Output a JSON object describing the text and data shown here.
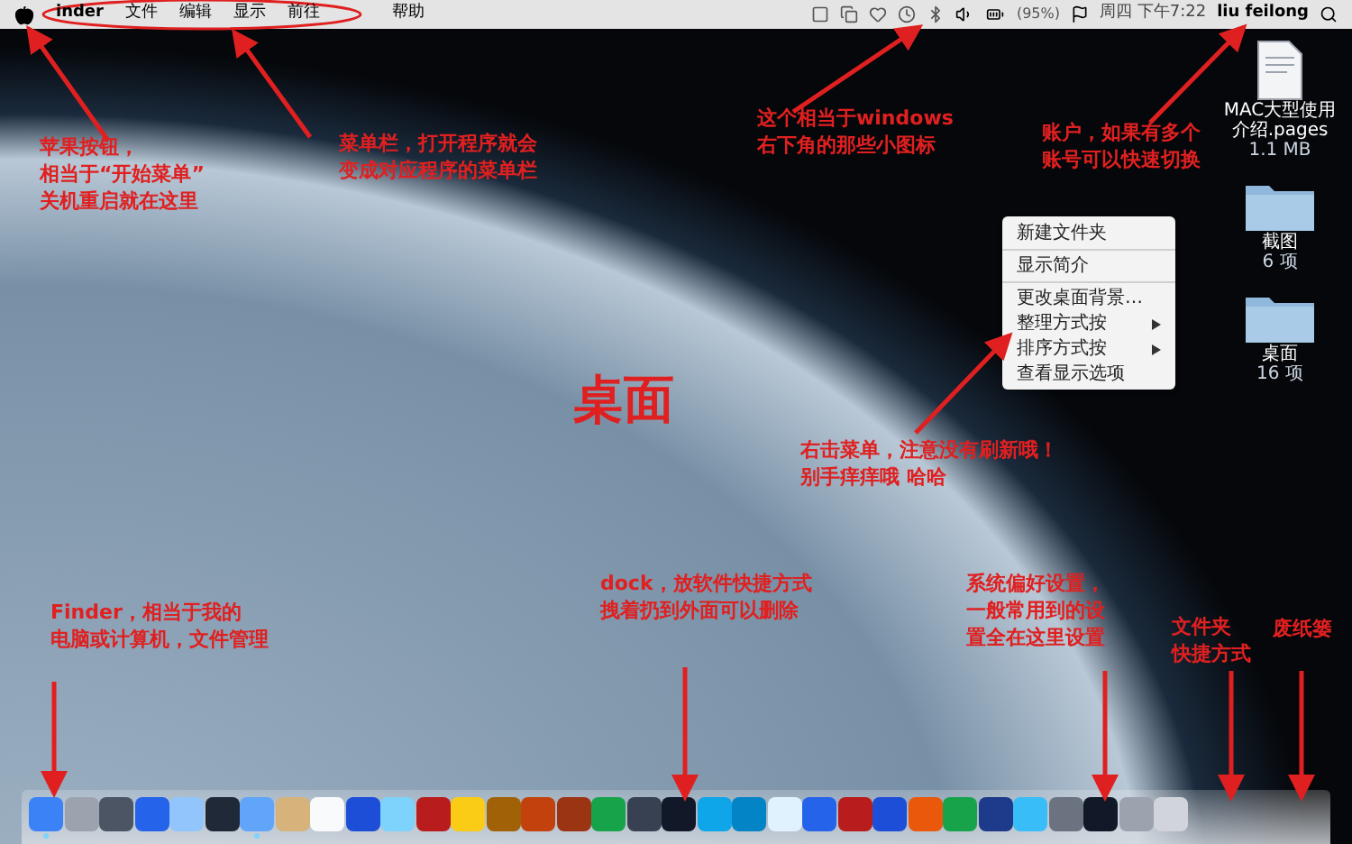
{
  "menu_bar": {
    "items": [
      {
        "label": "inder",
        "bold": true
      },
      {
        "label": "文件",
        "bold": false
      },
      {
        "label": "编辑",
        "bold": false
      },
      {
        "label": "显示",
        "bold": false
      },
      {
        "label": "前往",
        "bold": false
      },
      {
        "label": "帮助",
        "bold": false
      }
    ],
    "status": {
      "battery": "(95%)",
      "clock": "周四 下午7:22",
      "user": "liu feilong"
    }
  },
  "desktop_icons": [
    {
      "kind": "document",
      "name": "MAC大型使用介绍.pages",
      "info": "1.1 MB"
    },
    {
      "kind": "folder",
      "name": "截图",
      "info": "6 项"
    },
    {
      "kind": "folder",
      "name": "桌面",
      "info": "16 项"
    }
  ],
  "context_menu": [
    {
      "label": "新建文件夹",
      "divider_before": false,
      "submenu": false
    },
    {
      "label": "显示简介",
      "divider_before": true,
      "submenu": false
    },
    {
      "label": "更改桌面背景…",
      "divider_before": true,
      "submenu": false
    },
    {
      "label": "整理方式按",
      "divider_before": false,
      "submenu": true
    },
    {
      "label": "排序方式按",
      "divider_before": false,
      "submenu": true
    },
    {
      "label": "查看显示选项",
      "divider_before": false,
      "submenu": false
    }
  ],
  "annotations": [
    {
      "lines": [
        "苹果按钮，",
        "相当于“开始菜单”",
        "关机重启就在这里"
      ]
    },
    {
      "lines": [
        "菜单栏，打开程序就会",
        "变成对应程序的菜单栏"
      ]
    },
    {
      "lines": [
        "这个相当于windows",
        "右下角的那些小图标"
      ]
    },
    {
      "lines": [
        "账户，如果有多个",
        "账号可以快速切换"
      ]
    },
    {
      "lines": [
        "右击菜单，注意没有刷新哦！",
        "别手痒痒哦 哈哈"
      ]
    },
    {
      "lines": [
        "桌面"
      ]
    },
    {
      "lines": [
        "Finder，相当于我的",
        "电脑或计算机，文件管理"
      ]
    },
    {
      "lines": [
        "dock，放软件快捷方式",
        "拽着扔到外面可以删除"
      ]
    },
    {
      "lines": [
        "系统偏好设置，",
        "一般常用到的设",
        "置全在这里设置"
      ]
    },
    {
      "lines": [
        "文件夹",
        "快捷方式"
      ]
    },
    {
      "lines": [
        "废纸篓"
      ]
    }
  ],
  "dock": [
    {
      "running": true
    },
    {
      "running": false
    },
    {
      "running": false
    },
    {
      "running": false
    },
    {
      "running": false
    },
    {
      "running": false
    },
    {
      "running": true
    },
    {
      "running": false
    },
    {
      "running": false
    },
    {
      "running": false
    },
    {
      "running": false
    },
    {
      "running": false
    },
    {
      "running": false
    },
    {
      "running": false
    },
    {
      "running": false
    },
    {
      "running": false
    },
    {
      "running": false
    },
    {
      "running": false
    },
    {
      "running": false
    },
    {
      "running": false
    },
    {
      "running": false
    },
    {
      "running": false
    },
    {
      "running": false
    },
    {
      "running": false
    },
    {
      "running": false
    },
    {
      "running": false
    },
    {
      "running": false
    },
    {
      "running": false
    },
    {
      "running": false
    },
    {
      "running": false
    },
    {
      "running": false
    },
    {
      "running": false
    },
    {
      "running": false
    }
  ]
}
